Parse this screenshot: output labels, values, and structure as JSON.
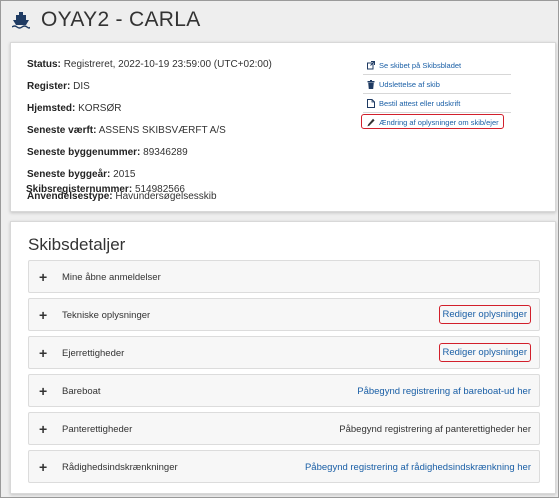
{
  "header": {
    "title": "OYAY2 - CARLA",
    "icon": "ship-icon"
  },
  "info": {
    "rows": [
      {
        "label": "Status:",
        "value": "Registreret, 2022-10-19 23:59:00 (UTC+02:00)"
      },
      {
        "label": "Register:",
        "value": "DIS"
      },
      {
        "label": "Hjemsted:",
        "value": "KORSØR"
      },
      {
        "label": "Seneste værft:",
        "value": "ASSENS SKIBSVÆRFT A/S"
      },
      {
        "label": "Seneste byggenummer:",
        "value": "89346289"
      },
      {
        "label": "Seneste byggeår:",
        "value": "2015"
      },
      {
        "label": "Anvendelsestype:",
        "value": "Havundersøgelsesskib"
      },
      {
        "label": "Skibsregisternummer:",
        "value": "514982566"
      }
    ],
    "actions": [
      {
        "label": "Se skibet på Skibsbladet",
        "icon": "external-link-icon"
      },
      {
        "label": "Udslettelse af skib",
        "icon": "trash-icon"
      },
      {
        "label": "Bestil attest eller udskrift",
        "icon": "document-icon"
      },
      {
        "label": "Ændring af oplysninger om skib/ejer",
        "icon": "pencil-icon"
      }
    ]
  },
  "details": {
    "title": "Skibsdetaljer",
    "sections": [
      {
        "label": "Mine åbne anmeldelser",
        "action": ""
      },
      {
        "label": "Tekniske oplysninger",
        "action": "Rediger oplysninger"
      },
      {
        "label": "Ejerrettigheder",
        "action": "Rediger oplysninger"
      },
      {
        "label": "Bareboat",
        "action": "Påbegynd registrering af bareboat-ud her"
      },
      {
        "label": "Panterettigheder",
        "action": "Påbegynd registrering af panterettigheder her"
      },
      {
        "label": "Rådighedsindskrænkninger",
        "action": "Påbegynd registrering af rådighedsindskrænkning her"
      }
    ]
  },
  "colors": {
    "link": "#1a5fa6",
    "highlight": "#d21f2b",
    "icon": "#1f3b63"
  }
}
